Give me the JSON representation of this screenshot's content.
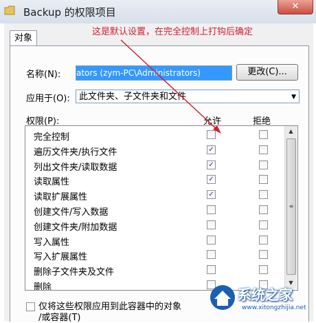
{
  "window": {
    "title": "Backup 的权限项目",
    "close_glyph": "✕"
  },
  "tabs": [
    {
      "label": "对象"
    }
  ],
  "name_row": {
    "label": "名称(N):",
    "value": "ators (zym-PC\\Administrators)",
    "change_button": "更改(C)..."
  },
  "apply_row": {
    "label": "应用于(O):",
    "value": "此文件夹、子文件夹和文件"
  },
  "permissions": {
    "header": "权限(P):",
    "col_allow": "允许",
    "col_deny": "拒绝",
    "rows": [
      {
        "name": "完全控制",
        "allow": false,
        "deny": false
      },
      {
        "name": "遍历文件夹/执行文件",
        "allow": true,
        "deny": false
      },
      {
        "name": "列出文件夹/读取数据",
        "allow": true,
        "deny": false
      },
      {
        "name": "读取属性",
        "allow": true,
        "deny": false
      },
      {
        "name": "读取扩展属性",
        "allow": true,
        "deny": false
      },
      {
        "name": "创建文件/写入数据",
        "allow": false,
        "deny": false
      },
      {
        "name": "创建文件夹/附加数据",
        "allow": false,
        "deny": false
      },
      {
        "name": "写入属性",
        "allow": false,
        "deny": false
      },
      {
        "name": "写入扩展属性",
        "allow": false,
        "deny": false
      },
      {
        "name": "删除子文件夹及文件",
        "allow": false,
        "deny": false
      },
      {
        "name": "删除",
        "allow": false,
        "deny": false
      }
    ]
  },
  "apply_only": {
    "line1": "仅将这些权限应用到此容器中的对象",
    "line2": "/或容器(T)",
    "checked": false
  },
  "annotation": {
    "text": "这是默认设置，在完全控制上打钩后确定",
    "color": "#d2202e"
  },
  "watermark": {
    "text": "系统之家",
    "sub": "www.xitongzhijia.net"
  },
  "icons": {
    "folder": "folder-icon",
    "close": "close-icon",
    "dropdown": "chevron-down-icon",
    "scroll_up": "scroll-up-icon",
    "scroll_down": "scroll-down-icon"
  }
}
